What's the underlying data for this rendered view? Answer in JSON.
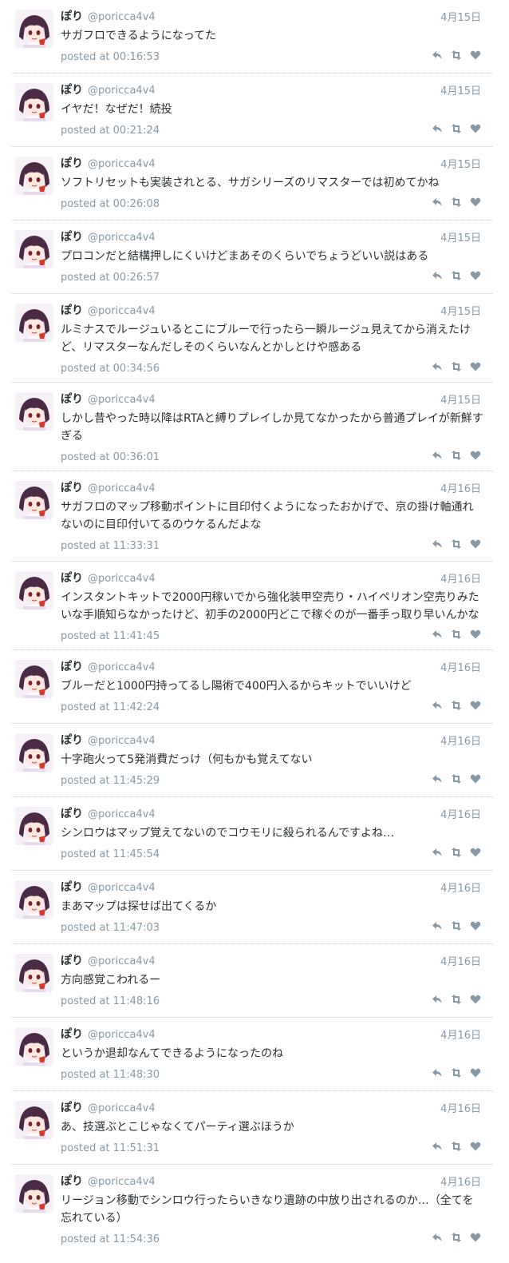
{
  "icons": {
    "reply": "reply-icon",
    "retweet": "retweet-icon",
    "like": "heart-icon"
  },
  "colors": {
    "muted": "#8899a6",
    "text": "#292f33",
    "divider": "#c8c8c8"
  },
  "tweets": [
    {
      "name": "ぽり",
      "handle": "@poricca4v4",
      "date": "4月15日",
      "text": "サガフロできるようになってた",
      "stamp": "posted at 00:16:53"
    },
    {
      "name": "ぽり",
      "handle": "@poricca4v4",
      "date": "4月15日",
      "text": "イヤだ！なぜだ！続投",
      "stamp": "posted at 00:21:24"
    },
    {
      "name": "ぽり",
      "handle": "@poricca4v4",
      "date": "4月15日",
      "text": "ソフトリセットも実装されとる、サガシリーズのリマスターでは初めてかね",
      "stamp": "posted at 00:26:08"
    },
    {
      "name": "ぽり",
      "handle": "@poricca4v4",
      "date": "4月15日",
      "text": "プロコンだと結構押しにくいけどまあそのくらいでちょうどいい説はある",
      "stamp": "posted at 00:26:57"
    },
    {
      "name": "ぽり",
      "handle": "@poricca4v4",
      "date": "4月15日",
      "text": "ルミナスでルージュいるとこにブルーで行ったら一瞬ルージュ見えてから消えたけど、リマスターなんだしそのくらいなんとかしとけや感ある",
      "stamp": "posted at 00:34:56"
    },
    {
      "name": "ぽり",
      "handle": "@poricca4v4",
      "date": "4月15日",
      "text": "しかし昔やった時以降はRTAと縛りプレイしか見てなかったから普通プレイが新鮮すぎる",
      "stamp": "posted at 00:36:01"
    },
    {
      "name": "ぽり",
      "handle": "@poricca4v4",
      "date": "4月16日",
      "text": "サガフロのマップ移動ポイントに目印付くようになったおかげで、京の掛け軸通れないのに目印付いてるのウケるんだよな",
      "stamp": "posted at 11:33:31"
    },
    {
      "name": "ぽり",
      "handle": "@poricca4v4",
      "date": "4月16日",
      "text": "インスタントキットで2000円稼いでから強化装甲空売り・ハイペリオン空売りみたいな手順知らなかったけど、初手の2000円どこで稼ぐのが一番手っ取り早いんかな",
      "stamp": "posted at 11:41:45"
    },
    {
      "name": "ぽり",
      "handle": "@poricca4v4",
      "date": "4月16日",
      "text": "ブルーだと1000円持ってるし陽術で400円入るからキットでいいけど",
      "stamp": "posted at 11:42:24"
    },
    {
      "name": "ぽり",
      "handle": "@poricca4v4",
      "date": "4月16日",
      "text": "十字砲火って5発消費だっけ（何もかも覚えてない",
      "stamp": "posted at 11:45:29"
    },
    {
      "name": "ぽり",
      "handle": "@poricca4v4",
      "date": "4月16日",
      "text": "シンロウはマップ覚えてないのでコウモリに殺られるんですよね…",
      "stamp": "posted at 11:45:54"
    },
    {
      "name": "ぽり",
      "handle": "@poricca4v4",
      "date": "4月16日",
      "text": "まあマップは探せば出てくるか",
      "stamp": "posted at 11:47:03"
    },
    {
      "name": "ぽり",
      "handle": "@poricca4v4",
      "date": "4月16日",
      "text": "方向感覚こわれるー",
      "stamp": "posted at 11:48:16"
    },
    {
      "name": "ぽり",
      "handle": "@poricca4v4",
      "date": "4月16日",
      "text": "というか退却なんてできるようになったのね",
      "stamp": "posted at 11:48:30"
    },
    {
      "name": "ぽり",
      "handle": "@poricca4v4",
      "date": "4月16日",
      "text": "あ、技選ぶとこじゃなくてパーティ選ぶほうか",
      "stamp": "posted at 11:51:31"
    },
    {
      "name": "ぽり",
      "handle": "@poricca4v4",
      "date": "4月16日",
      "text": "リージョン移動でシンロウ行ったらいきなり遺跡の中放り出されるのか…（全てを忘れている）",
      "stamp": "posted at 11:54:36"
    }
  ]
}
